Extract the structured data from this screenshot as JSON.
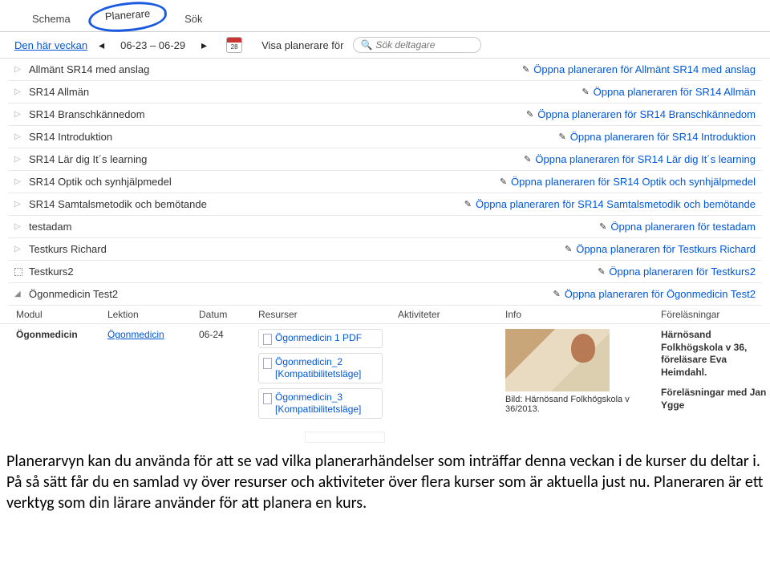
{
  "tabs": {
    "schema": "Schema",
    "planerare": "Planerare",
    "sok": "Sök"
  },
  "toolbar": {
    "week_link": "Den här veckan",
    "date_range": "06-23  –  06-29",
    "cal_day": "28",
    "vp_label": "Visa planerare för",
    "search_placeholder": "Sök deltagare"
  },
  "courses": [
    {
      "name": "Allmänt SR14 med anslag",
      "link": "Öppna planeraren för Allmänt SR14 med anslag",
      "type": "closed"
    },
    {
      "name": "SR14 Allmän",
      "link": "Öppna planeraren för SR14 Allmän",
      "type": "closed"
    },
    {
      "name": "SR14 Branschkännedom",
      "link": "Öppna planeraren för SR14 Branschkännedom",
      "type": "closed"
    },
    {
      "name": "SR14 Introduktion",
      "link": "Öppna planeraren för SR14 Introduktion",
      "type": "closed"
    },
    {
      "name": "SR14 Lär dig It´s learning",
      "link": "Öppna planeraren för SR14 Lär dig It´s learning",
      "type": "closed"
    },
    {
      "name": "SR14 Optik och synhjälpmedel",
      "link": "Öppna planeraren för SR14 Optik och synhjälpmedel",
      "type": "closed"
    },
    {
      "name": "SR14 Samtalsmetodik och bemötande",
      "link": "Öppna planeraren för SR14 Samtalsmetodik och bemötande",
      "type": "closed"
    },
    {
      "name": "testadam",
      "link": "Öppna planeraren för testadam",
      "type": "closed"
    },
    {
      "name": "Testkurs Richard",
      "link": "Öppna planeraren för Testkurs Richard",
      "type": "closed"
    },
    {
      "name": "Testkurs2",
      "link": "Öppna planeraren för Testkurs2",
      "type": "boxed"
    },
    {
      "name": "Ögonmedicin Test2",
      "link": "Öppna planeraren för Ögonmedicin Test2",
      "type": "expanded"
    }
  ],
  "detail_headers": {
    "modul": "Modul",
    "lektion": "Lektion",
    "datum": "Datum",
    "resurser": "Resurser",
    "aktiviteter": "Aktiviteter",
    "info": "Info",
    "forelasningar": "Föreläsningar"
  },
  "detail": {
    "modul": "Ögonmedicin",
    "lektion": "Ögonmedicin",
    "datum": "06-24",
    "resources": [
      "Ögonmedicin 1 PDF",
      "Ögonmedicin_2 [Kompatibilitetsläge]",
      "Ögonmedicin_3 [Kompatibilitetsläge]"
    ],
    "info_caption": "Bild: Härnösand Folkhögskola v 36/2013.",
    "fore1": "Härnösand Folkhögskola v 36, föreläsare Eva Heimdahl.",
    "fore2": "Föreläsningar med Jan Ygge"
  },
  "description_text": "Planerarvyn kan du använda för att se vad vilka planerarhändelser som inträffar denna veckan i de kurser du deltar i. På så sätt får du en samlad vy över resurser och aktiviteter över flera kurser som är aktuella just nu. Planeraren är ett verktyg som din lärare använder för att planera en kurs."
}
